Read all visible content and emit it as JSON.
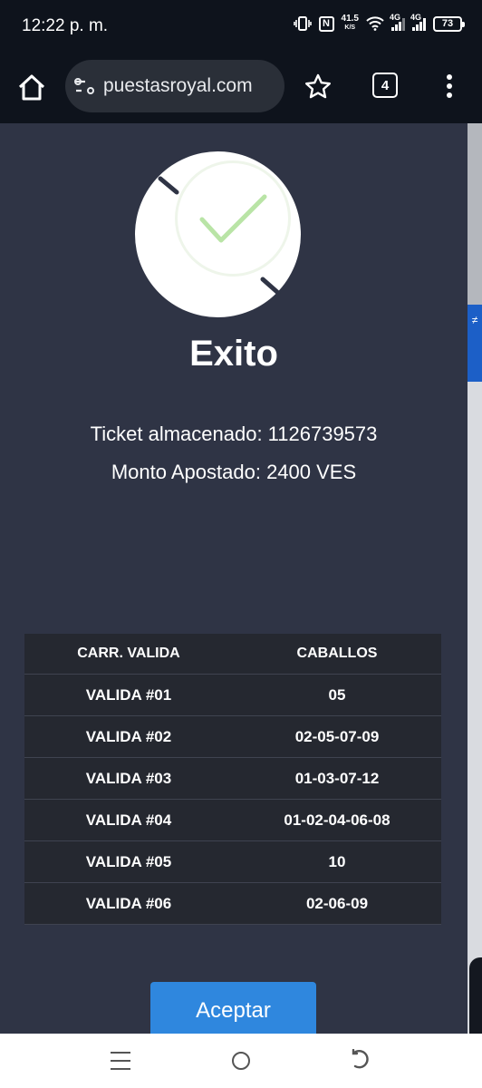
{
  "status_bar": {
    "time": "12:22 p. m.",
    "net_speed_value": "41.5",
    "net_speed_unit": "K/S",
    "network_1": "4G",
    "network_2": "4G",
    "battery": "73",
    "icons": [
      "vibrate-icon",
      "nfc-icon",
      "wifi-icon",
      "signal-icon",
      "signal-icon",
      "battery-icon"
    ]
  },
  "browser": {
    "url": "puestasroyal.com",
    "tab_count": "4",
    "icons": [
      "home-icon",
      "site-settings-icon",
      "star-icon",
      "tabs-icon",
      "more-vert-icon"
    ]
  },
  "side_tab": {
    "label": "≠"
  },
  "modal": {
    "title": "Exito",
    "ticket_line": "Ticket almacenado: 1126739573",
    "amount_line": "Monto Apostado: 2400 VES",
    "icon": "check-icon",
    "accent_color": "#a5dc86"
  },
  "table": {
    "headers": [
      "CARR. VALIDA",
      "CABALLOS"
    ],
    "rows": [
      [
        "VALIDA #01",
        "05"
      ],
      [
        "VALIDA #02",
        "02-05-07-09"
      ],
      [
        "VALIDA #03",
        "01-03-07-12"
      ],
      [
        "VALIDA #04",
        "01-02-04-06-08"
      ],
      [
        "VALIDA #05",
        "10"
      ],
      [
        "VALIDA #06",
        "02-06-09"
      ]
    ]
  },
  "accept_button": {
    "label": "Aceptar",
    "color": "#2f87de"
  },
  "nav_bar": {
    "icons": [
      "recents-icon",
      "home-circle-icon",
      "back-icon"
    ]
  }
}
